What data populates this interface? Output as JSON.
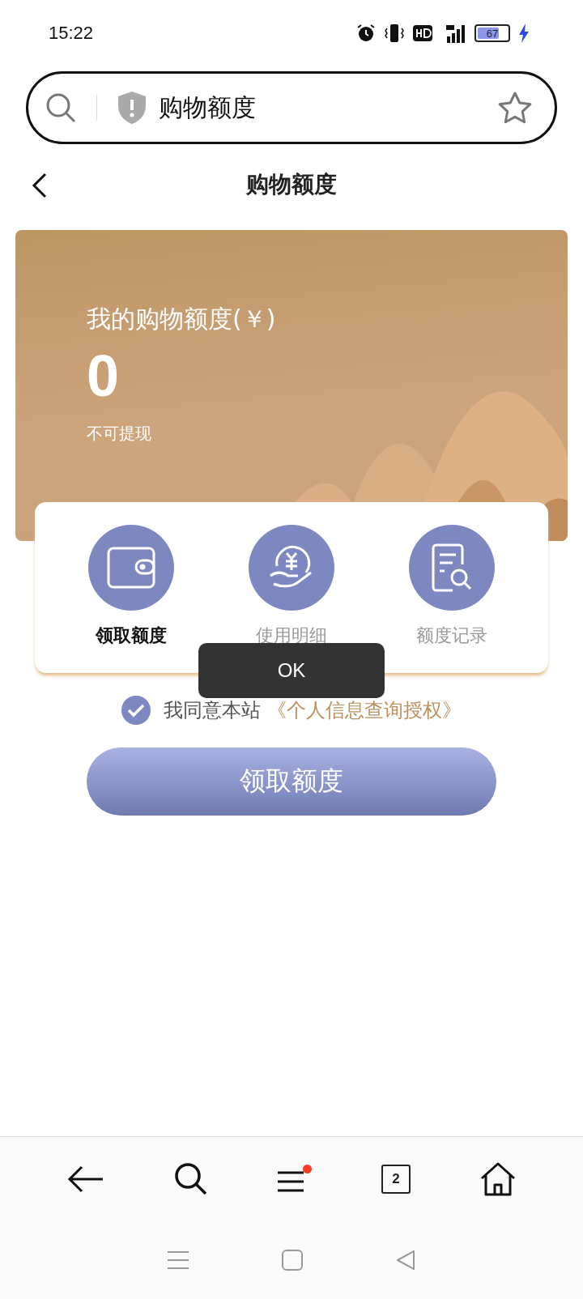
{
  "status_bar": {
    "time": "15:22",
    "battery": "67"
  },
  "address_bar": {
    "value": "购物额度"
  },
  "header": {
    "title": "购物额度"
  },
  "quota_card": {
    "label": "我的购物额度(￥)",
    "amount": "0",
    "note": "不可提现"
  },
  "actions": [
    {
      "kind": "wallet",
      "label": "领取额度",
      "selected": true
    },
    {
      "kind": "coin",
      "label": "使用明细",
      "selected": false
    },
    {
      "kind": "record",
      "label": "额度记录",
      "selected": false
    }
  ],
  "toast": {
    "text": "OK"
  },
  "agreement": {
    "checked": true,
    "text": "我同意本站",
    "link": "《个人信息查询授权》"
  },
  "claim_button": {
    "label": "领取额度"
  },
  "browser_nav": {
    "tabs_count": "2",
    "menu_badge": true
  }
}
